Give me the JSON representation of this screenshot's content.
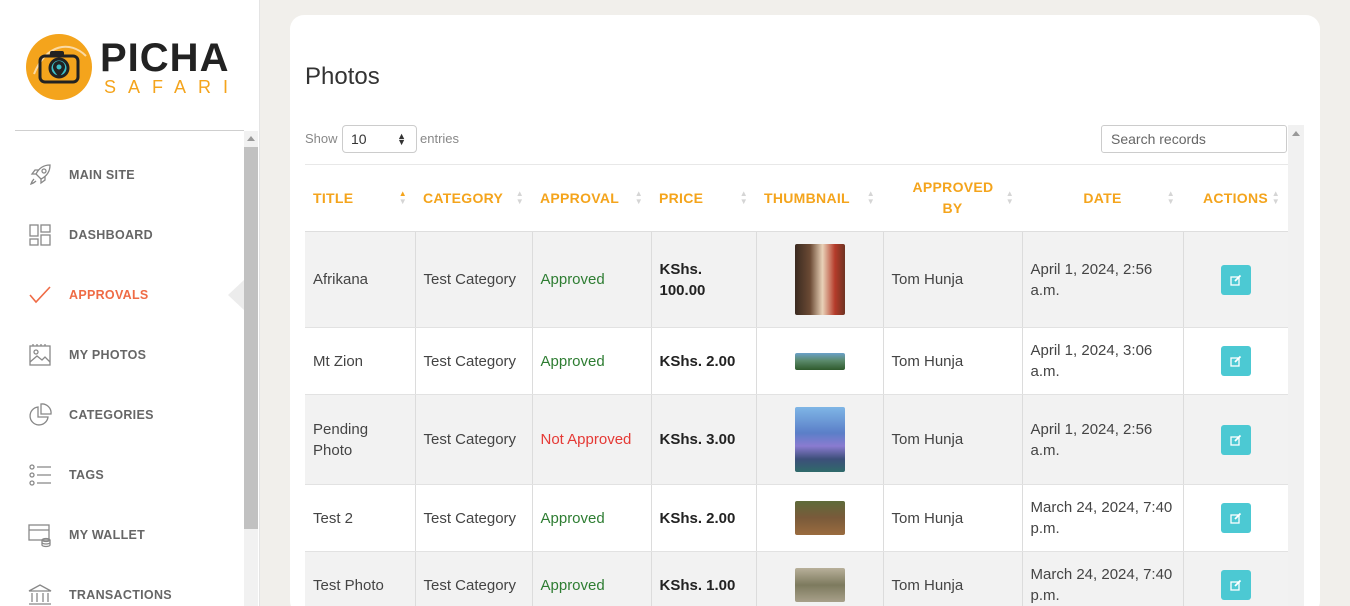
{
  "brand": {
    "name_top": "PICHA",
    "name_bottom": "SAFARI"
  },
  "nav": [
    {
      "label": "MAIN SITE",
      "icon": "rocket-icon"
    },
    {
      "label": "DASHBOARD",
      "icon": "dashboard-icon"
    },
    {
      "label": "APPROVALS",
      "icon": "checkmark-icon",
      "active": true
    },
    {
      "label": "MY PHOTOS",
      "icon": "photo-icon"
    },
    {
      "label": "CATEGORIES",
      "icon": "pie-chart-icon"
    },
    {
      "label": "TAGS",
      "icon": "list-icon"
    },
    {
      "label": "MY WALLET",
      "icon": "wallet-icon"
    },
    {
      "label": "TRANSACTIONS",
      "icon": "bank-icon"
    }
  ],
  "page": {
    "title": "Photos",
    "show_label": "Show",
    "entries_value": "10",
    "entries_label": "entries",
    "search_placeholder": "Search records"
  },
  "table": {
    "columns": [
      "TITLE",
      "CATEGORY",
      "APPROVAL",
      "PRICE",
      "THUMBNAIL",
      "APPROVED BY",
      "DATE",
      "ACTIONS"
    ],
    "rows": [
      {
        "title": "Afrikana",
        "category": "Test Category",
        "approval": "Approved",
        "price": "KShs. 100.00",
        "approved_by": "Tom Hunja",
        "date": "April 1, 2024, 2:56 a.m.",
        "thumb": "portrait"
      },
      {
        "title": "Mt Zion",
        "category": "Test Category",
        "approval": "Approved",
        "price": "KShs. 2.00",
        "approved_by": "Tom Hunja",
        "date": "April 1, 2024, 3:06 a.m.",
        "thumb": "landscape"
      },
      {
        "title": "Pending Photo",
        "category": "Test Category",
        "approval": "Not Approved",
        "price": "KShs. 3.00",
        "approved_by": "Tom Hunja",
        "date": "April 1, 2024, 2:56 a.m.",
        "thumb": "city"
      },
      {
        "title": "Test 2",
        "category": "Test Category",
        "approval": "Approved",
        "price": "KShs. 2.00",
        "approved_by": "Tom Hunja",
        "date": "March 24, 2024, 7:40 p.m.",
        "thumb": "wildlife"
      },
      {
        "title": "Test Photo",
        "category": "Test Category",
        "approval": "Approved",
        "price": "KShs. 1.00",
        "approved_by": "Tom Hunja",
        "date": "March 24, 2024, 7:40 p.m.",
        "thumb": "savanna"
      }
    ]
  },
  "colors": {
    "accent": "#f4a41c",
    "active_nav": "#ef6b45",
    "approved": "#2e7d32",
    "not_approved": "#e53935",
    "edit_button": "#4cc9d3"
  }
}
